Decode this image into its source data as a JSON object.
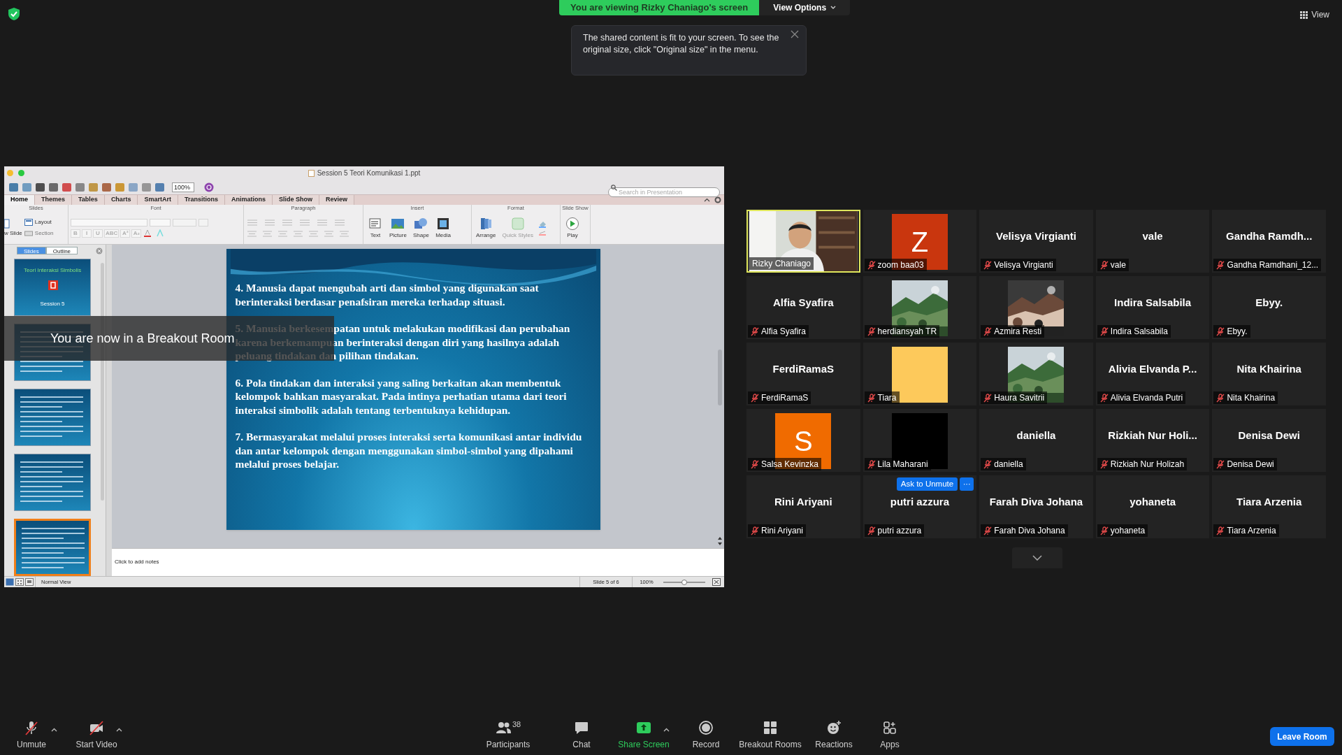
{
  "share_banner": {
    "text": "You are viewing Rizky Chaniago's screen",
    "view_options": "View Options"
  },
  "tooltip": {
    "text": "The shared content is fit to your screen. To see the original size, click \"Original size\" in the menu."
  },
  "view_button": "View",
  "presentation": {
    "title": "Session 5 Teori Komunikasi 1.ppt",
    "zoom": "100%",
    "search_placeholder": "Search in Presentation",
    "tabs": [
      {
        "label": "Home",
        "selected": true
      },
      {
        "label": "Themes",
        "selected": false
      },
      {
        "label": "Tables",
        "selected": false
      },
      {
        "label": "Charts",
        "selected": false
      },
      {
        "label": "SmartArt",
        "selected": false
      },
      {
        "label": "Transitions",
        "selected": false
      },
      {
        "label": "Animations",
        "selected": false
      },
      {
        "label": "Slide Show",
        "selected": false
      },
      {
        "label": "Review",
        "selected": false
      }
    ],
    "groups": [
      {
        "label": "Slides",
        "kind": "slides"
      },
      {
        "label": "Font",
        "kind": "font"
      },
      {
        "label": "Paragraph",
        "kind": "paragraph"
      },
      {
        "label": "Insert",
        "kind": "insert"
      },
      {
        "label": "Format",
        "kind": "format"
      },
      {
        "label": "Slide Show",
        "kind": "show"
      }
    ],
    "slides_group": {
      "new_slide": "w Slide",
      "layout": "Layout",
      "section": "Section"
    },
    "font_buttons": [
      "B",
      "I",
      "U",
      "ABC",
      "A²",
      "A₂"
    ],
    "insert_buttons": [
      "Text",
      "Picture",
      "Shape",
      "Media"
    ],
    "format_buttons": [
      "Arrange",
      "Quick Styles"
    ],
    "play_button": "Play",
    "pane_tabs": [
      {
        "label": "Slides",
        "selected": true
      },
      {
        "label": "Outline",
        "selected": false
      }
    ],
    "thumbnails": [
      {
        "title": "Teori Interaksi Simbolis",
        "subtitle": "Session 5",
        "selected": false
      },
      {
        "selected": false
      },
      {
        "selected": false
      },
      {
        "selected": false
      },
      {
        "selected": true
      }
    ],
    "slide_points": [
      "4. Manusia dapat mengubah arti dan simbol yang digunakan saat berinteraksi berdasar penafsiran mereka terhadap situasi.",
      "5. Manusia berkesempatan untuk melakukan modifikasi dan perubahan karena berkemampuan berinteraksi dengan diri yang hasilnya adalah peluang tindakan dan pilihan tindakan.",
      "6. Pola tindakan dan interaksi yang saling berkaitan akan membentuk kelompok bahkan masyarakat. Pada intinya perhatian utama dari teori interaksi simbolik adalah tentang terbentuknya kehidupan.",
      "7. Bermasyarakat melalui proses interaksi serta komunikasi antar individu dan antar kelompok dengan menggunakan simbol-simbol yang dipahami melalui proses belajar."
    ],
    "notes_placeholder": "Click to add notes",
    "status": {
      "view": "Normal View",
      "slide": "Slide 5 of 6",
      "zoom": "100%",
      "zoom_slider": {
        "level": 0.5
      }
    }
  },
  "breakout_notice": "You are now in a Breakout Room",
  "participants": [
    {
      "kind": "video",
      "name": "Rizky Chaniago",
      "muted": false,
      "active": true
    },
    {
      "kind": "avatar",
      "letter": "Z",
      "color": "#c9360e",
      "name": "zoom baa03",
      "muted": true,
      "active": false
    },
    {
      "kind": "text",
      "display": "Velisya Virgianti",
      "name": "Velisya Virgianti",
      "muted": true,
      "active": false
    },
    {
      "kind": "text",
      "display": "vale",
      "name": "vale",
      "muted": true,
      "active": false
    },
    {
      "kind": "text",
      "display": "Gandha Ramdh...",
      "name": "Gandha Ramdhani_12...",
      "muted": true,
      "active": false
    },
    {
      "kind": "text",
      "display": "Alfia Syafira",
      "name": "Alfia Syafira",
      "muted": true,
      "active": false
    },
    {
      "kind": "picture",
      "name": "herdiansyah TR",
      "muted": true,
      "active": false
    },
    {
      "kind": "picture",
      "name": "Azmira Resti",
      "muted": true,
      "active": false
    },
    {
      "kind": "text",
      "display": "Indira Salsabila",
      "name": "Indira Salsabila",
      "muted": true,
      "active": false
    },
    {
      "kind": "text",
      "display": "Ebyy.",
      "name": "Ebyy.",
      "muted": true,
      "active": false
    },
    {
      "kind": "text",
      "display": "FerdiRamaS",
      "name": "FerdiRamaS",
      "muted": true,
      "active": false
    },
    {
      "kind": "color",
      "color": "#fdc95b",
      "name": "Tiara",
      "muted": true,
      "active": false
    },
    {
      "kind": "picture",
      "name": "Haura Savitrii",
      "muted": true,
      "active": false
    },
    {
      "kind": "text",
      "display": "Alivia Elvanda P...",
      "name": "Alivia Elvanda Putri",
      "muted": true,
      "active": false
    },
    {
      "kind": "text",
      "display": "Nita Khairina",
      "name": "Nita Khairina",
      "muted": true,
      "active": false
    },
    {
      "kind": "avatar",
      "letter": "S",
      "color": "#f06b00",
      "name": "Salsa Kevinzka",
      "muted": true,
      "active": false
    },
    {
      "kind": "color",
      "color": "#000000",
      "name": "Lila Maharani",
      "muted": true,
      "active": false
    },
    {
      "kind": "text",
      "display": "daniella",
      "name": "daniella",
      "muted": true,
      "active": false
    },
    {
      "kind": "text",
      "display": "Rizkiah Nur Holi...",
      "name": "Rizkiah Nur Holizah",
      "muted": true,
      "active": false
    },
    {
      "kind": "text",
      "display": "Denisa Dewi",
      "name": "Denisa Dewi",
      "muted": true,
      "active": false
    },
    {
      "kind": "text",
      "display": "Rini Ariyani",
      "name": "Rini Ariyani",
      "muted": true,
      "active": false
    },
    {
      "kind": "text",
      "display": "putri azzura",
      "name": "putri azzura",
      "muted": true,
      "active": false,
      "actions": {
        "ask": "Ask to Unmute",
        "more": "···"
      }
    },
    {
      "kind": "text",
      "display": "Farah Diva Johana",
      "name": "Farah Diva Johana",
      "muted": true,
      "active": false
    },
    {
      "kind": "text",
      "display": "yohaneta",
      "name": "yohaneta",
      "muted": true,
      "active": false
    },
    {
      "kind": "text",
      "display": "Tiara Arzenia",
      "name": "Tiara Arzenia",
      "muted": true,
      "active": false
    }
  ],
  "toolbar": [
    {
      "label": "Unmute",
      "kind": "mic_off",
      "caret": true
    },
    {
      "label": "Start Video",
      "kind": "video_off",
      "caret": true
    },
    {
      "label": "Participants",
      "kind": "people",
      "count": "38",
      "caret": false
    },
    {
      "label": "Chat",
      "kind": "chat",
      "caret": false
    },
    {
      "label": "Share Screen",
      "kind": "share",
      "caret": true
    },
    {
      "label": "Record",
      "kind": "record",
      "caret": false
    },
    {
      "label": "Breakout Rooms",
      "kind": "breakout",
      "caret": false
    },
    {
      "label": "Reactions",
      "kind": "reactions",
      "caret": false
    },
    {
      "label": "Apps",
      "kind": "apps",
      "caret": false
    }
  ],
  "leave_button": "Leave Room"
}
